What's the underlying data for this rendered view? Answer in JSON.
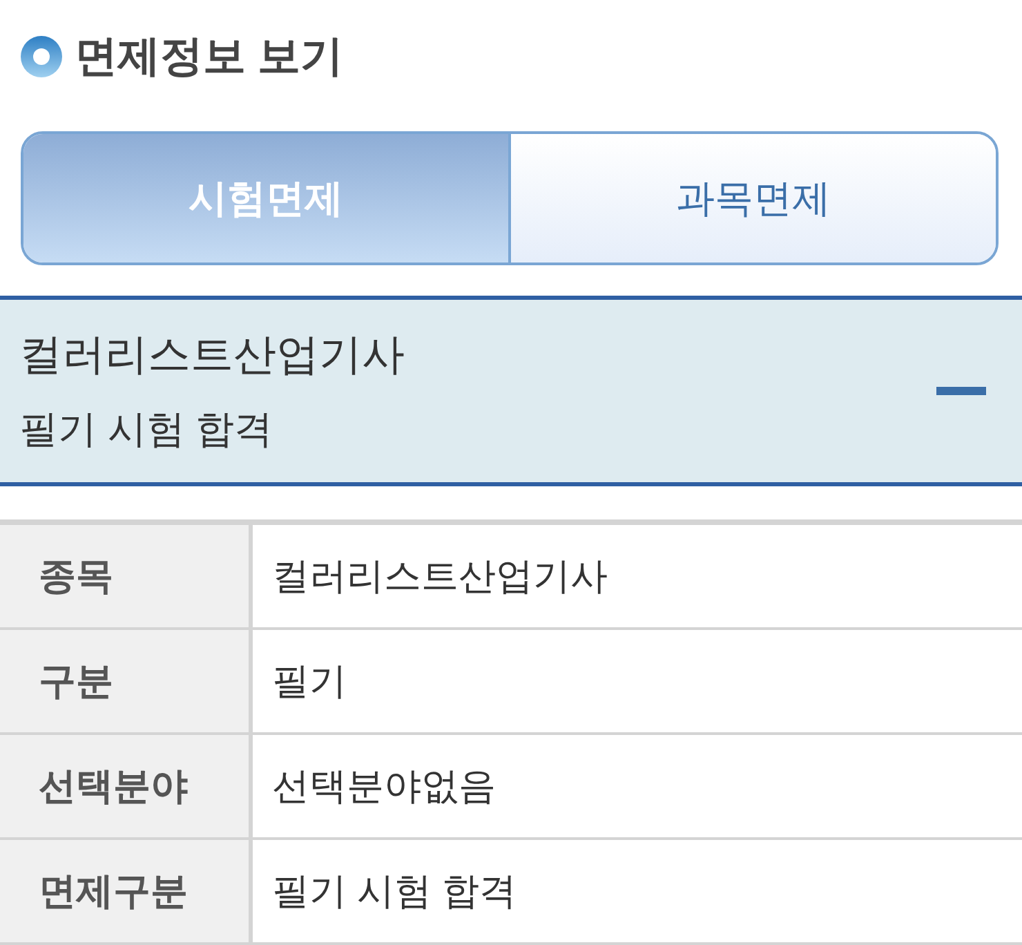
{
  "page_title": "면제정보 보기",
  "tabs": [
    {
      "label": "시험면제",
      "selected": true
    },
    {
      "label": "과목면제",
      "selected": false
    }
  ],
  "accordion": {
    "title": "컬러리스트산업기사",
    "subtitle": "필기 시험 합격",
    "expanded": true
  },
  "table": {
    "rows": [
      {
        "label": "종목",
        "value": "컬러리스트산업기사"
      },
      {
        "label": "구분",
        "value": "필기"
      },
      {
        "label": "선택분야",
        "value": "선택분야없음"
      },
      {
        "label": "면제구분",
        "value": "필기 시험 합격"
      }
    ]
  }
}
